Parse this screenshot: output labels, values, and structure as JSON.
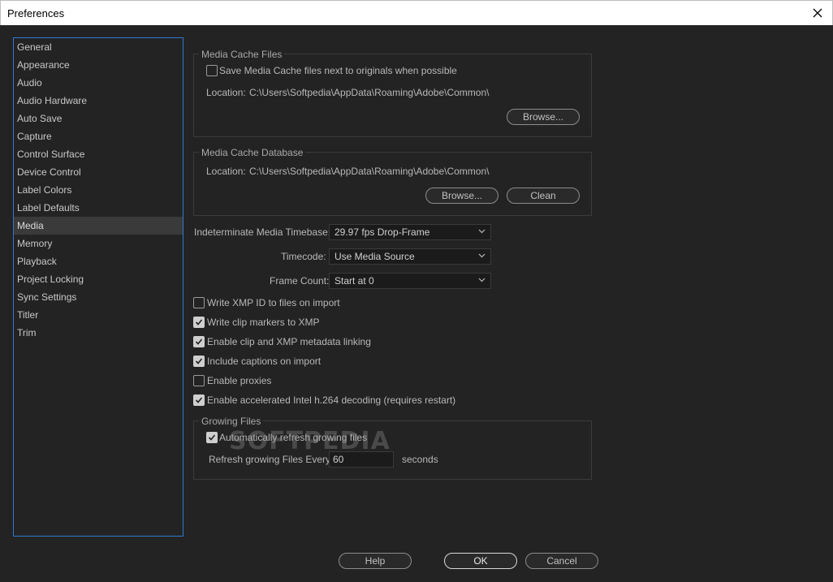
{
  "window": {
    "title": "Preferences"
  },
  "sidebar": {
    "items": [
      {
        "label": "General"
      },
      {
        "label": "Appearance"
      },
      {
        "label": "Audio"
      },
      {
        "label": "Audio Hardware"
      },
      {
        "label": "Auto Save"
      },
      {
        "label": "Capture"
      },
      {
        "label": "Control Surface"
      },
      {
        "label": "Device Control"
      },
      {
        "label": "Label Colors"
      },
      {
        "label": "Label Defaults"
      },
      {
        "label": "Media",
        "selected": true
      },
      {
        "label": "Memory"
      },
      {
        "label": "Playback"
      },
      {
        "label": "Project Locking"
      },
      {
        "label": "Sync Settings"
      },
      {
        "label": "Titler"
      },
      {
        "label": "Trim"
      }
    ]
  },
  "media_cache_files": {
    "title": "Media Cache Files",
    "save_next_label": "Save Media Cache files next to originals when possible",
    "save_next_checked": false,
    "location_label": "Location:",
    "location_value": "C:\\Users\\Softpedia\\AppData\\Roaming\\Adobe\\Common\\",
    "browse_label": "Browse..."
  },
  "media_cache_database": {
    "title": "Media Cache Database",
    "location_label": "Location:",
    "location_value": "C:\\Users\\Softpedia\\AppData\\Roaming\\Adobe\\Common\\",
    "browse_label": "Browse...",
    "clean_label": "Clean"
  },
  "settings": {
    "timebase_label": "Indeterminate Media Timebase:",
    "timebase_value": "29.97 fps Drop-Frame",
    "timecode_label": "Timecode:",
    "timecode_value": "Use Media Source",
    "frame_count_label": "Frame Count:",
    "frame_count_value": "Start at 0"
  },
  "options": {
    "write_xmp_id": {
      "label": "Write XMP ID to files on import",
      "checked": false
    },
    "write_clip_markers": {
      "label": "Write clip markers to XMP",
      "checked": true
    },
    "enable_clip_xmp": {
      "label": "Enable clip and XMP metadata linking",
      "checked": true
    },
    "include_captions": {
      "label": "Include captions on import",
      "checked": true
    },
    "enable_proxies": {
      "label": "Enable proxies",
      "checked": false
    },
    "accelerated_h264": {
      "label": "Enable accelerated Intel h.264 decoding (requires restart)",
      "checked": true
    }
  },
  "growing_files": {
    "title": "Growing Files",
    "auto_refresh_label": "Automatically refresh growing files",
    "auto_refresh_checked": true,
    "refresh_every_label": "Refresh growing Files Every",
    "refresh_value": "60",
    "seconds_label": "seconds"
  },
  "footer": {
    "help_label": "Help",
    "ok_label": "OK",
    "cancel_label": "Cancel"
  },
  "watermark": {
    "text": "SOFTPEDIA"
  }
}
